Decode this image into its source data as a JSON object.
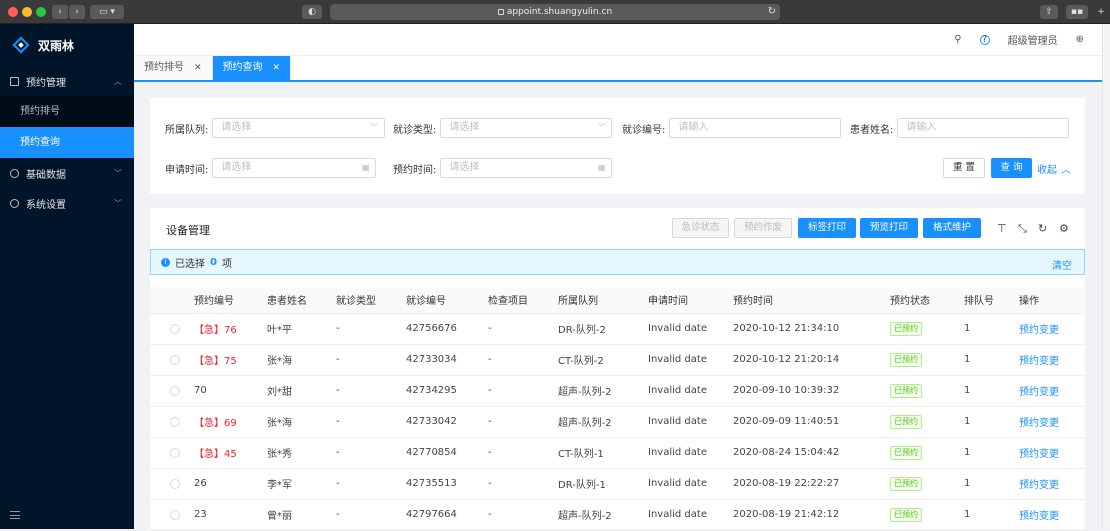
{
  "browser": {
    "url": "appoint.shuangyulin.cn"
  },
  "app": {
    "title": "双雨林"
  },
  "sidebar": {
    "groups": [
      {
        "label": "预约管理",
        "items": [
          "预约排号",
          "预约查询"
        ]
      },
      {
        "label": "基础数据"
      },
      {
        "label": "系统设置"
      }
    ]
  },
  "header": {
    "user": "超级管理员"
  },
  "tabs": [
    {
      "label": "预约排号",
      "active": false
    },
    {
      "label": "预约查询",
      "active": true
    }
  ],
  "search": {
    "queue_label": "所属队列:",
    "queue_placeholder": "请选择",
    "visit_label": "就诊类型:",
    "visit_placeholder": "请选择",
    "visitno_label": "就诊编号:",
    "visitno_placeholder": "请输入",
    "name_label": "患者姓名:",
    "name_placeholder": "请输入",
    "apply_label": "申请时间:",
    "apply_placeholder": "请选择",
    "appt_label": "预约时间:",
    "appt_placeholder": "请选择",
    "reset": "重 置",
    "query": "查 询",
    "collapse": "收起"
  },
  "panel": {
    "title": "设备管理",
    "btn_urgent": "急诊状态",
    "btn_cancel": "预约作废",
    "btn_label_print": "标签打印",
    "btn_preview_print": "预览打印",
    "btn_format": "格式维护"
  },
  "alert": {
    "prefix": "已选择",
    "count": "0",
    "suffix": "项",
    "clear": "清空"
  },
  "table": {
    "headers": [
      "预约编号",
      "患者姓名",
      "就诊类型",
      "就诊编号",
      "检查项目",
      "所属队列",
      "申请时间",
      "预约时间",
      "预约状态",
      "排队号",
      "操作"
    ],
    "rows": [
      {
        "urgent": "【急】",
        "no": "76",
        "name": "叶*平",
        "type": "-",
        "visit": "42756676",
        "item": "-",
        "queue": "DR-队列-2",
        "apply": "Invalid date",
        "time": "2020-10-12 21:34:10",
        "status": "已预约",
        "q": "1",
        "op": "预约变更"
      },
      {
        "urgent": "【急】",
        "no": "75",
        "name": "张*海",
        "type": "-",
        "visit": "42733034",
        "item": "-",
        "queue": "CT-队列-2",
        "apply": "Invalid date",
        "time": "2020-10-12 21:20:14",
        "status": "已预约",
        "q": "1",
        "op": "预约变更"
      },
      {
        "urgent": "",
        "no": "70",
        "name": "刘*甜",
        "type": "-",
        "visit": "42734295",
        "item": "-",
        "queue": "超声-队列-2",
        "apply": "Invalid date",
        "time": "2020-09-10 10:39:32",
        "status": "已预约",
        "q": "1",
        "op": "预约变更"
      },
      {
        "urgent": "【急】",
        "no": "69",
        "name": "张*海",
        "type": "-",
        "visit": "42733042",
        "item": "-",
        "queue": "超声-队列-2",
        "apply": "Invalid date",
        "time": "2020-09-09 11:40:51",
        "status": "已预约",
        "q": "1",
        "op": "预约变更"
      },
      {
        "urgent": "【急】",
        "no": "45",
        "name": "张*秀",
        "type": "-",
        "visit": "42770854",
        "item": "-",
        "queue": "CT-队列-1",
        "apply": "Invalid date",
        "time": "2020-08-24 15:04:42",
        "status": "已预约",
        "q": "1",
        "op": "预约变更"
      },
      {
        "urgent": "",
        "no": "26",
        "name": "李*军",
        "type": "-",
        "visit": "42735513",
        "item": "-",
        "queue": "DR-队列-1",
        "apply": "Invalid date",
        "time": "2020-08-19 22:22:27",
        "status": "已预约",
        "q": "1",
        "op": "预约变更"
      },
      {
        "urgent": "",
        "no": "23",
        "name": "曾*丽",
        "type": "-",
        "visit": "42797664",
        "item": "-",
        "queue": "超声-队列-2",
        "apply": "Invalid date",
        "time": "2020-08-19 21:42:12",
        "status": "已预约",
        "q": "1",
        "op": "预约变更"
      }
    ]
  }
}
